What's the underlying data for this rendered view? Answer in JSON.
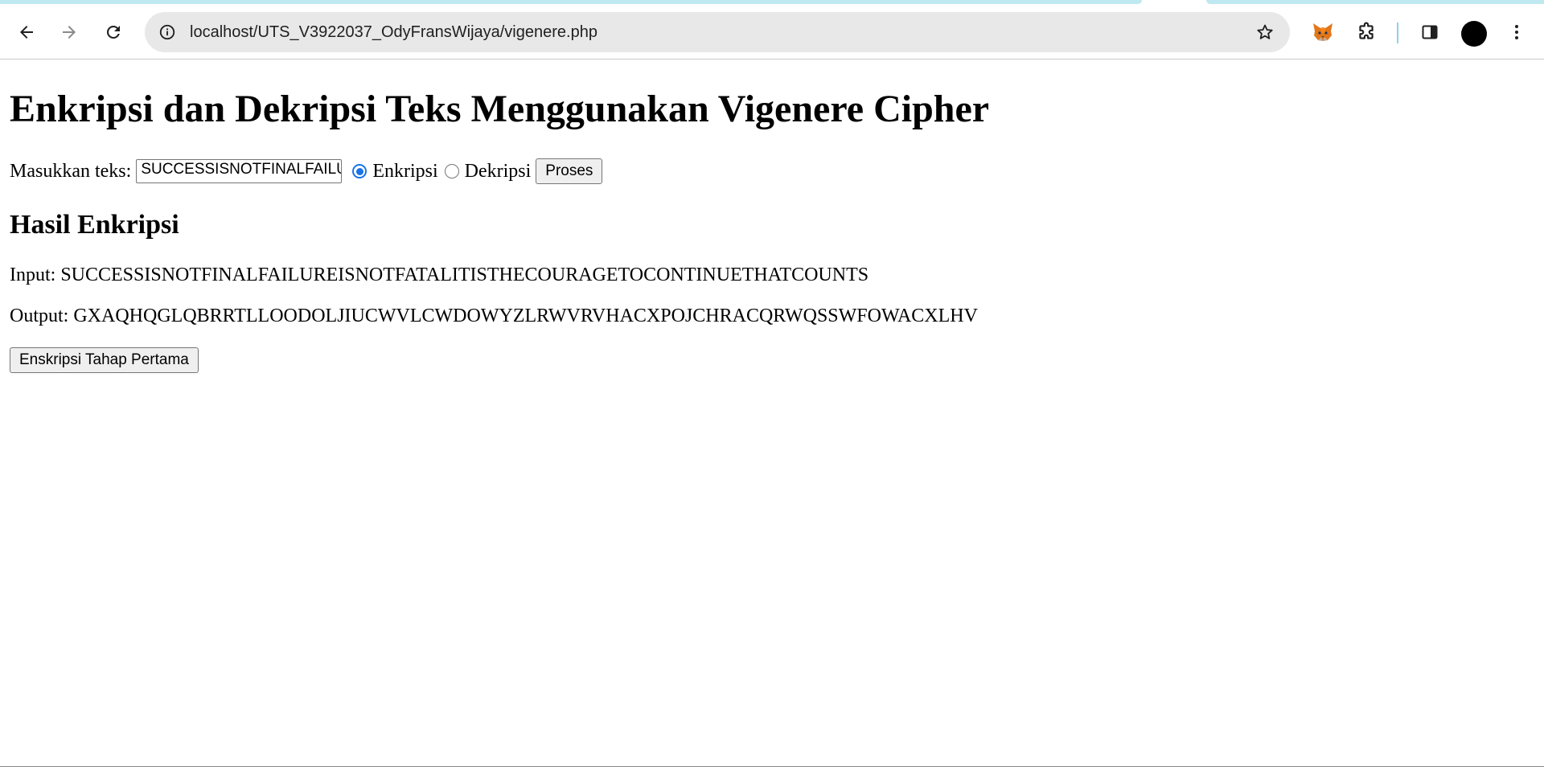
{
  "browser": {
    "url": "localhost/UTS_V3922037_OdyFransWijaya/vigenere.php",
    "icons": {
      "back": "arrow-left-icon",
      "forward": "arrow-right-icon",
      "reload": "reload-icon",
      "site_info": "info-icon",
      "bookmark": "star-icon",
      "extension_fox": "metamask-fox-icon",
      "extensions": "puzzle-icon",
      "side_panel": "side-panel-icon",
      "menu": "kebab-menu-icon"
    },
    "accent_color": "#bfe8f0"
  },
  "page": {
    "title": "Enkripsi dan Dekripsi Teks Menggunakan Vigenere Cipher",
    "form": {
      "input_label": "Masukkan teks:",
      "input_value": "SUCCESSISNOTFINALFAILUREISNOTFATALITISTHECOURAGETOCONTINUETHATCOUNTS",
      "radio_encrypt_label": "Enkripsi",
      "radio_decrypt_label": "Dekripsi",
      "selected_mode": "Enkripsi",
      "submit_label": "Proses"
    },
    "result": {
      "heading": "Hasil Enkripsi",
      "input_line": "Input: SUCCESSISNOTFINALFAILUREISNOTFATALITISTHECOURAGETOCONTINUETHATCOUNTS",
      "output_line": "Output: GXAQHQGLQBRRTLLOODOLJIUCWVLCWDOWYZLRWVRVHACXPOJCHRACQRWQSSWFOWACXLHV",
      "stage_button_label": "Enskripsi Tahap Pertama"
    }
  }
}
